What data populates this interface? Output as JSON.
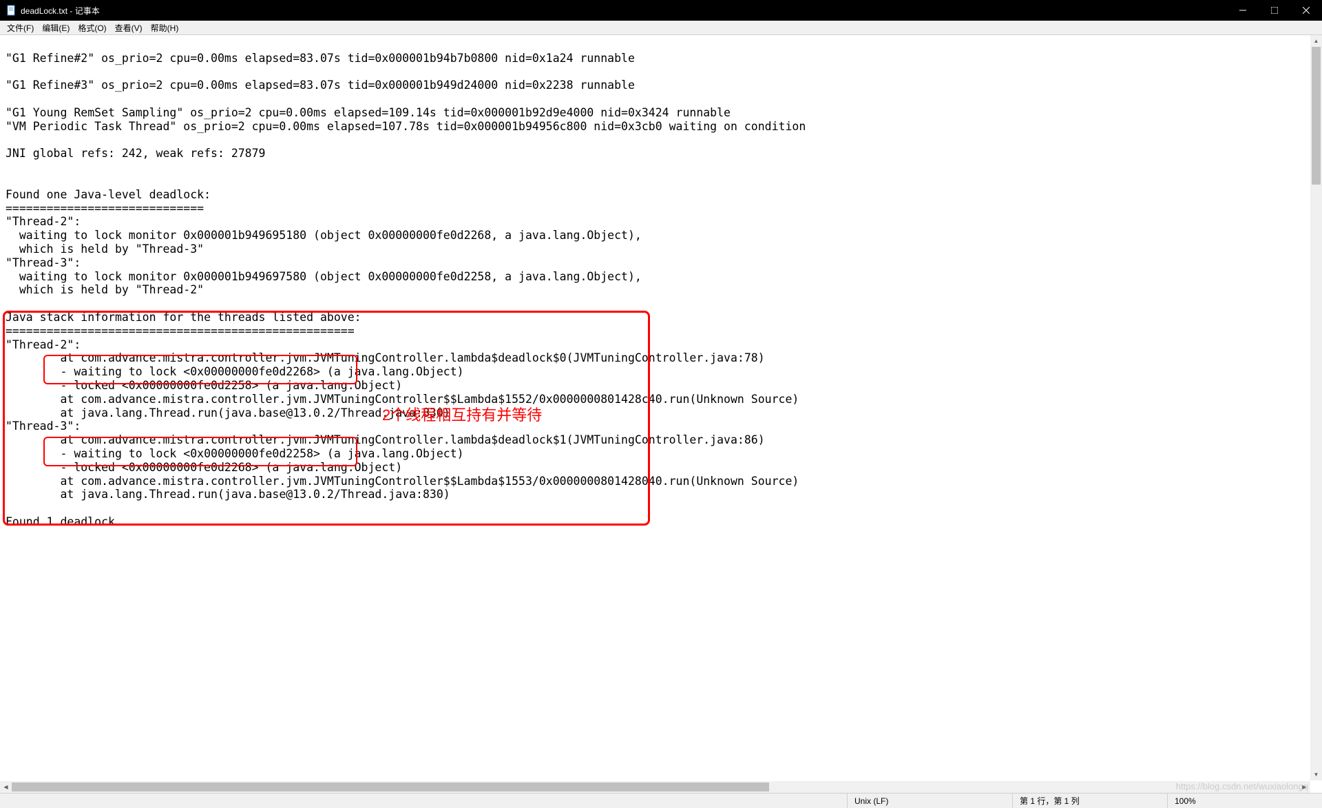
{
  "window": {
    "title": "deadLock.txt - 记事本"
  },
  "menu": {
    "file": "文件(F)",
    "edit": "编辑(E)",
    "format": "格式(O)",
    "view": "查看(V)",
    "help": "帮助(H)"
  },
  "content": {
    "lines": [
      "",
      "\"G1 Refine#2\" os_prio=2 cpu=0.00ms elapsed=83.07s tid=0x000001b94b7b0800 nid=0x1a24 runnable",
      "",
      "\"G1 Refine#3\" os_prio=2 cpu=0.00ms elapsed=83.07s tid=0x000001b949d24000 nid=0x2238 runnable",
      "",
      "\"G1 Young RemSet Sampling\" os_prio=2 cpu=0.00ms elapsed=109.14s tid=0x000001b92d9e4000 nid=0x3424 runnable",
      "\"VM Periodic Task Thread\" os_prio=2 cpu=0.00ms elapsed=107.78s tid=0x000001b94956c800 nid=0x3cb0 waiting on condition",
      "",
      "JNI global refs: 242, weak refs: 27879",
      "",
      "",
      "Found one Java-level deadlock:",
      "=============================",
      "\"Thread-2\":",
      "  waiting to lock monitor 0x000001b949695180 (object 0x00000000fe0d2268, a java.lang.Object),",
      "  which is held by \"Thread-3\"",
      "\"Thread-3\":",
      "  waiting to lock monitor 0x000001b949697580 (object 0x00000000fe0d2258, a java.lang.Object),",
      "  which is held by \"Thread-2\"",
      "",
      "Java stack information for the threads listed above:",
      "===================================================",
      "\"Thread-2\":",
      "        at com.advance.mistra.controller.jvm.JVMTuningController.lambda$deadlock$0(JVMTuningController.java:78)",
      "        - waiting to lock <0x00000000fe0d2268> (a java.lang.Object)",
      "        - locked <0x00000000fe0d2258> (a java.lang.Object)",
      "        at com.advance.mistra.controller.jvm.JVMTuningController$$Lambda$1552/0x0000000801428c40.run(Unknown Source)",
      "        at java.lang.Thread.run(java.base@13.0.2/Thread.java:830)",
      "\"Thread-3\":",
      "        at com.advance.mistra.controller.jvm.JVMTuningController.lambda$deadlock$1(JVMTuningController.java:86)",
      "        - waiting to lock <0x00000000fe0d2258> (a java.lang.Object)",
      "        - locked <0x00000000fe0d2268> (a java.lang.Object)",
      "        at com.advance.mistra.controller.jvm.JVMTuningController$$Lambda$1553/0x0000000801428040.run(Unknown Source)",
      "        at java.lang.Thread.run(java.base@13.0.2/Thread.java:830)",
      "",
      "Found 1 deadlock.",
      ""
    ]
  },
  "annotation": {
    "text": "2个线程相互持有并等待"
  },
  "statusbar": {
    "encoding_line": "Unix (LF)",
    "position": "第 1 行，第 1 列",
    "zoom": "100%"
  },
  "watermark": "https://blog.csdn.net/wuxiaolongq"
}
